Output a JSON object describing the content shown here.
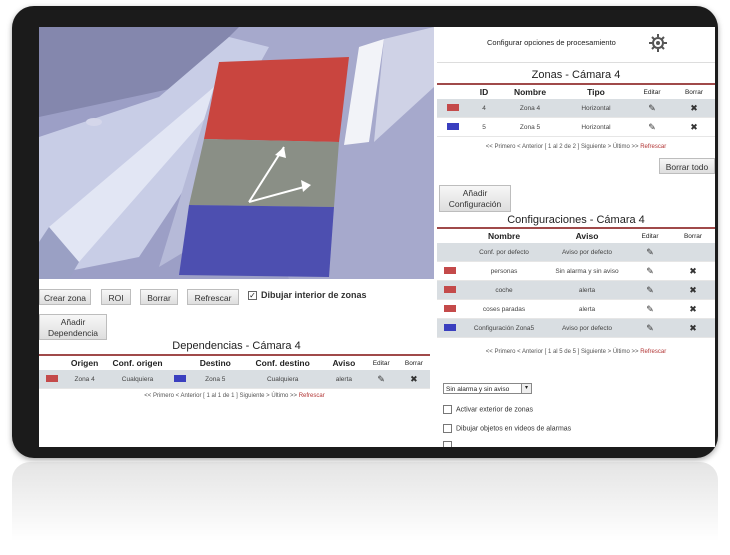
{
  "buttons": {
    "crear_zona": "Crear zona",
    "roi": "ROI",
    "borrar": "Borrar",
    "refrescar": "Refrescar",
    "dibujar_interior": "Dibujar interior de zonas",
    "anadir_dependencia": [
      "Añadir",
      "Dependencia"
    ],
    "anadir_configuracion": [
      "Añadir",
      "Configuración"
    ],
    "borrar_todo": "Borrar todo"
  },
  "processing": {
    "label": "Configurar opciones de procesamiento",
    "icon": "gear-icon"
  },
  "zonas": {
    "title": "Zonas - Cámara 4",
    "headers": [
      "ID",
      "Nombre",
      "Tipo",
      "Editar",
      "Borrar"
    ],
    "rows": [
      {
        "color": "#c44a4a",
        "id": "4",
        "nombre": "Zona 4",
        "tipo": "Horizontal"
      },
      {
        "color": "#3a3fbf",
        "id": "5",
        "nombre": "Zona 5",
        "tipo": "Horizontal"
      }
    ],
    "pager": {
      "text": "<< Primero < Anterior [ 1 al 2 de 2 ] Siguiente > Último >>",
      "refresh": "Refrescar"
    }
  },
  "configuraciones": {
    "title": "Configuraciones - Cámara 4",
    "headers": [
      "Nombre",
      "Aviso",
      "Editar",
      "Borrar"
    ],
    "rows": [
      {
        "color": "",
        "nombre": "Conf. por defecto",
        "aviso": "Aviso por defecto"
      },
      {
        "color": "#c44a4a",
        "nombre": "personas",
        "aviso": "Sin alarma y sin aviso"
      },
      {
        "color": "#c44a4a",
        "nombre": "coche",
        "aviso": "alerta"
      },
      {
        "color": "#c44a4a",
        "nombre": "coses paradas",
        "aviso": "alerta"
      },
      {
        "color": "#3a3fbf",
        "nombre": "Configuración Zona5",
        "aviso": "Aviso por defecto"
      }
    ],
    "pager": {
      "text": "<< Primero < Anterior [ 1 al 5 de 5 ] Siguiente > Último >>",
      "refresh": "Refrescar"
    }
  },
  "dependencias": {
    "title": "Dependencias - Cámara 4",
    "headers": [
      "Origen",
      "Conf. origen",
      "Destino",
      "Conf. destino",
      "Aviso",
      "Editar",
      "Borrar"
    ],
    "rows": [
      {
        "origen_color": "#c44a4a",
        "origen": "Zona 4",
        "conf_origen": "Cualquiera",
        "destino_color": "#3a3fbf",
        "destino": "Zona 5",
        "conf_destino": "Cualquiera",
        "aviso": "alerta"
      }
    ],
    "pager": {
      "text": "<< Primero < Anterior [ 1 al 1 de 1 ] Siguiente > Último >>",
      "refresh": "Refrescar"
    }
  },
  "options": {
    "select_value": "Sin alarma y sin aviso",
    "activar_exterior": "Activar exterior de zonas",
    "dibujar_objetos": "Dibujar objetos en videos de alarmas"
  },
  "colors": {
    "zone_red": "#c44a4a",
    "zone_blue": "#3a3fbf",
    "link_red": "#b23535",
    "header_line": "#a04a4a"
  }
}
